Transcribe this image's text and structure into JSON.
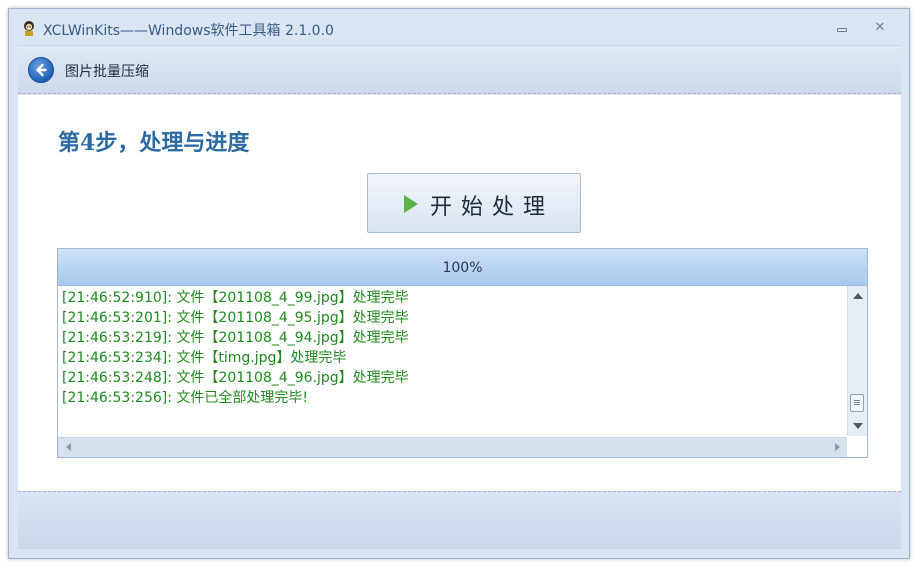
{
  "window": {
    "title": "XCLWinKits——Windows软件工具箱 2.1.0.0",
    "minimize_glyph": "",
    "close_glyph": "✕"
  },
  "nav": {
    "title": "图片批量压缩"
  },
  "step": {
    "title_prefix": "第",
    "title_number": "4",
    "title_suffix": "步，处理与进度"
  },
  "start_button": {
    "label": "开始处理"
  },
  "progress": {
    "percent": 100,
    "label": "100%"
  },
  "log": {
    "lines": [
      "[21:46:52:910]: 文件【201108_4_99.jpg】处理完毕",
      "[21:46:53:201]: 文件【201108_4_95.jpg】处理完毕",
      "[21:46:53:219]: 文件【201108_4_94.jpg】处理完毕",
      "[21:46:53:234]: 文件【timg.jpg】处理完毕",
      "[21:46:53:248]: 文件【201108_4_96.jpg】处理完毕",
      "[21:46:53:256]: 文件已全部处理完毕!"
    ]
  },
  "colors": {
    "accent": "#2c6aa1",
    "log_text": "#1f8a1f",
    "window_bg": "#d9e5f3"
  }
}
